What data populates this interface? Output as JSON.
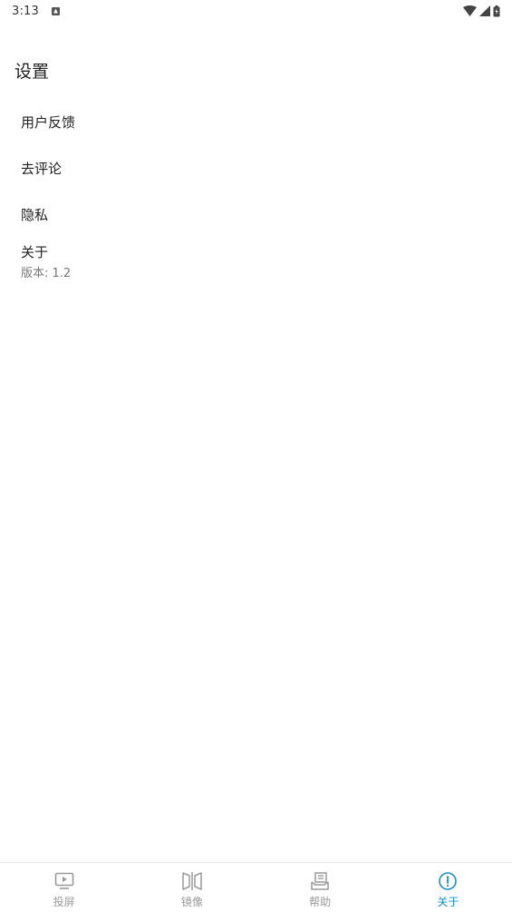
{
  "status_bar": {
    "time": "3:13"
  },
  "page": {
    "title": "设置"
  },
  "settings": {
    "items": [
      {
        "label": "用户反馈"
      },
      {
        "label": "去评论"
      },
      {
        "label": "隐私"
      },
      {
        "label": "关于",
        "sub": "版本: 1.2"
      }
    ]
  },
  "bottom_nav": {
    "items": [
      {
        "label": "投屏",
        "icon": "cast-screen-icon"
      },
      {
        "label": "镜像",
        "icon": "mirror-icon"
      },
      {
        "label": "帮助",
        "icon": "help-icon"
      },
      {
        "label": "关于",
        "icon": "info-icon"
      }
    ],
    "active_index": 3,
    "active_color": "#1a8fc6",
    "inactive_color": "#9a9a9a"
  }
}
